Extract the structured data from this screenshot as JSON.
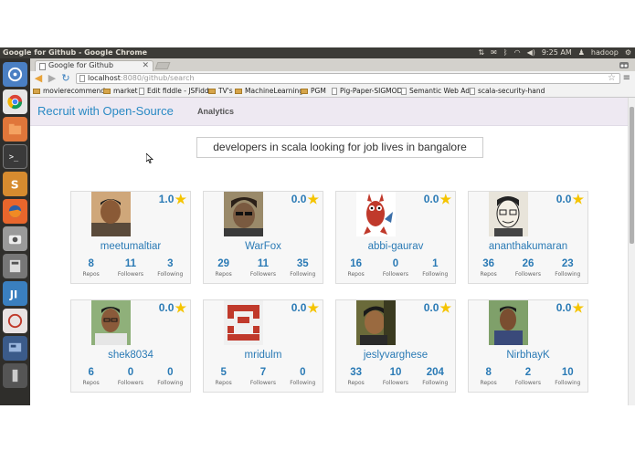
{
  "window": {
    "title": "Google for Github - Google Chrome",
    "time": "9:25 AM",
    "user": "hadoop"
  },
  "browser": {
    "tab_title": "Google for Github",
    "url_host": "localhost",
    "url_rest": ":8080/github/search",
    "bookmarks": [
      {
        "label": "movierecommend",
        "kind": "folder"
      },
      {
        "label": "market",
        "kind": "folder"
      },
      {
        "label": "Edit fiddle - JSFidd",
        "kind": "page"
      },
      {
        "label": "TV's",
        "kind": "folder"
      },
      {
        "label": "MachineLearning",
        "kind": "folder"
      },
      {
        "label": "PGM",
        "kind": "folder"
      },
      {
        "label": "Pig-Paper-SIGMOD",
        "kind": "page"
      },
      {
        "label": "Semantic Web Adv",
        "kind": "page"
      },
      {
        "label": "scala-security-hand",
        "kind": "page"
      }
    ]
  },
  "app": {
    "brand": "Recruit with Open-Source",
    "nav_link": "Analytics",
    "search_query": "developers in scala looking for job lives in bangalore",
    "stat_labels": {
      "repos": "Repos",
      "followers": "Followers",
      "following": "Following"
    }
  },
  "results": [
    {
      "username": "meetumaltiar",
      "rating": "1.0",
      "repos": "8",
      "followers": "11",
      "following": "3",
      "avatar": "avatar-photo"
    },
    {
      "username": "WarFox",
      "rating": "0.0",
      "repos": "29",
      "followers": "11",
      "following": "35",
      "avatar": "avatar-photo"
    },
    {
      "username": "abbi-gaurav",
      "rating": "0.0",
      "repos": "16",
      "followers": "0",
      "following": "1",
      "avatar": "avatar-bsd-daemon"
    },
    {
      "username": "ananthakumaran",
      "rating": "0.0",
      "repos": "36",
      "followers": "26",
      "following": "23",
      "avatar": "avatar-sketch"
    },
    {
      "username": "shek8034",
      "rating": "0.0",
      "repos": "6",
      "followers": "0",
      "following": "0",
      "avatar": "avatar-photo"
    },
    {
      "username": "mridulm",
      "rating": "0.0",
      "repos": "5",
      "followers": "7",
      "following": "0",
      "avatar": "avatar-identicon"
    },
    {
      "username": "jeslyvarghese",
      "rating": "0.0",
      "repos": "33",
      "followers": "10",
      "following": "204",
      "avatar": "avatar-photo"
    },
    {
      "username": "NirbhayK",
      "rating": "0.0",
      "repos": "8",
      "followers": "2",
      "following": "10",
      "avatar": "avatar-photo"
    }
  ],
  "colors": {
    "accent": "#2a8ac4",
    "star": "#f5c400",
    "navbar_bg": "#eee9f2",
    "identicon": "#c0392b"
  }
}
